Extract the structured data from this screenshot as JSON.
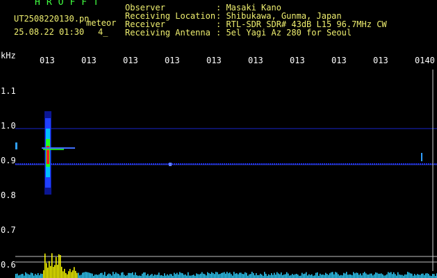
{
  "header": {
    "brand": "HROFFT",
    "filename": "UT2508220130.pn",
    "tag": "meteor",
    "datetime": "25.08.22 01:30",
    "counter": "4_",
    "fields": [
      {
        "label": "Observer",
        "value": ": Masaki Kano"
      },
      {
        "label": "Receiving Location",
        "value": ": Shibukawa, Gunma, Japan"
      },
      {
        "label": "Receiver",
        "value": ": RTL-SDR SDR# 43dB L15 96.7MHz CW"
      },
      {
        "label": "Receiving Antenna",
        "value": ": 5el Yagi Az 280 for Seoul"
      }
    ]
  },
  "axis": {
    "unit": "kHz",
    "y_ticks": [
      "1.1",
      "1.0",
      "0.9",
      "0.8",
      "0.7",
      "0.6"
    ],
    "x_ticks": [
      "013",
      "013",
      "013",
      "013",
      "013",
      "013",
      "013",
      "013",
      "013",
      "0140"
    ]
  },
  "colors": {
    "label_yellow": "#f0f070",
    "brand_green": "#40ff40",
    "tick_white": "#ffffff",
    "noise_blue": "#2030ff",
    "hot_red": "#ff2020",
    "mid_green": "#20ff20",
    "spectrum_cyan": "#30d0ff",
    "spectrum_yellow": "#ffff00"
  }
}
